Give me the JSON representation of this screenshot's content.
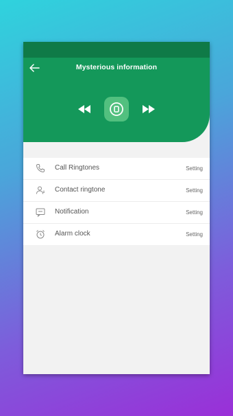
{
  "header": {
    "title": "Mysterious information",
    "back_icon": "back-arrow-icon"
  },
  "player": {
    "prev_icon": "rewind-icon",
    "play_icon": "play-stop-icon",
    "next_icon": "fast-forward-icon"
  },
  "settings": {
    "items": [
      {
        "label": "Call Ringtones",
        "action": "Setting",
        "icon": "phone-icon"
      },
      {
        "label": "Contact ringtone",
        "action": "Setting",
        "icon": "contact-icon"
      },
      {
        "label": "Notification",
        "action": "Setting",
        "icon": "message-icon"
      },
      {
        "label": "Alarm clock",
        "action": "Setting",
        "icon": "alarm-clock-icon"
      }
    ]
  },
  "colors": {
    "header_green": "#14985a",
    "status_green": "#0f7a47",
    "button_green": "#52c07f",
    "background_gradient_start": "#2fd3dd",
    "background_gradient_end": "#9a2fd8"
  }
}
